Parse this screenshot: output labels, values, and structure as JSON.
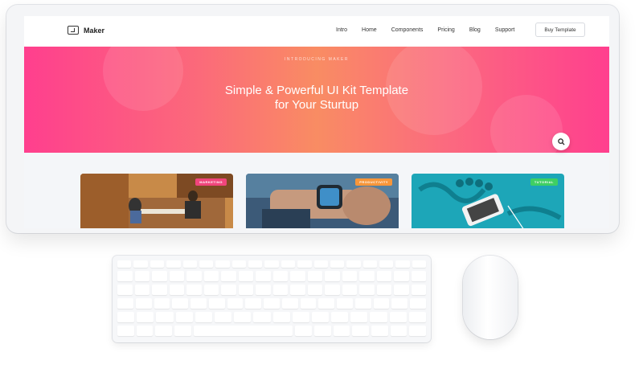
{
  "nav": {
    "brand": "Maker",
    "items": [
      "Intro",
      "Home",
      "Components",
      "Pricing",
      "Blog",
      "Support"
    ],
    "cta": "Buy Template"
  },
  "hero": {
    "eyebrow": "INTRODUCING MAKER",
    "title_line1": "Simple & Powerful UI Kit Template",
    "title_line2": "for Your Sturtup",
    "search_icon": "search-icon"
  },
  "cards": [
    {
      "badge": "MARKETING",
      "badge_color": "#f0457c",
      "scene": "office-meeting"
    },
    {
      "badge": "PRODUCTIVITY",
      "badge_color": "#f7963a",
      "scene": "smartwatch"
    },
    {
      "badge": "TUTORIAL",
      "badge_color": "#3fcf63",
      "scene": "phone-on-teal"
    }
  ],
  "colors": {
    "hero_pink": "#ff3f8e",
    "hero_orange": "#f98c63",
    "screen_bg": "#f4f6f9"
  }
}
